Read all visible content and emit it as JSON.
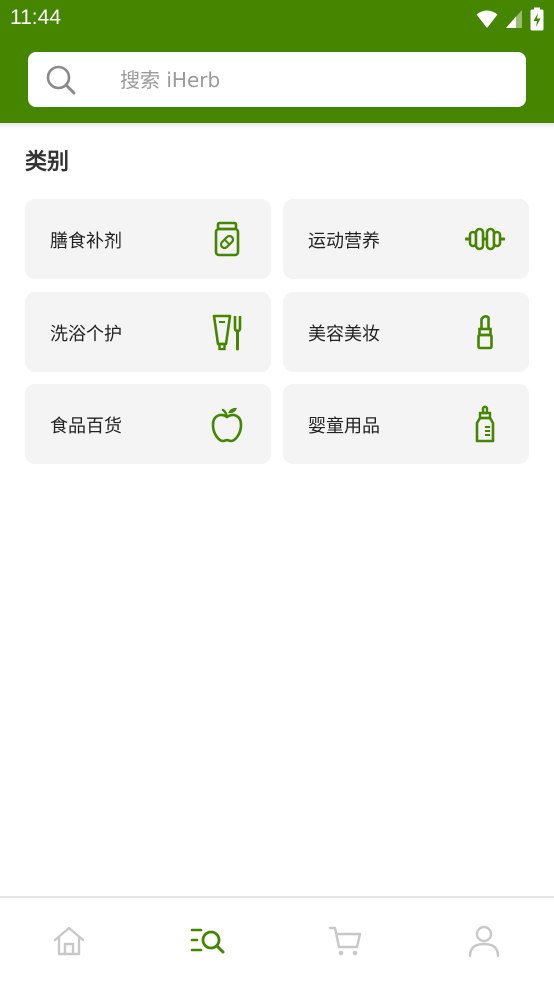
{
  "status_bar": {
    "time": "11:44"
  },
  "search": {
    "placeholder": "搜索 iHerb",
    "value": ""
  },
  "section": {
    "title": "类别"
  },
  "categories": [
    {
      "label": "膳食补剂",
      "icon": "supplement-jar-icon"
    },
    {
      "label": "运动营养",
      "icon": "dumbbell-icon"
    },
    {
      "label": "洗浴个护",
      "icon": "tube-and-brush-icon"
    },
    {
      "label": "美容美妆",
      "icon": "lipstick-icon"
    },
    {
      "label": "食品百货",
      "icon": "apple-icon"
    },
    {
      "label": "婴童用品",
      "icon": "baby-bottle-icon"
    }
  ],
  "bottom_nav": [
    {
      "name": "home",
      "icon": "home-icon",
      "active": false
    },
    {
      "name": "browse",
      "icon": "browse-search-icon",
      "active": true
    },
    {
      "name": "cart",
      "icon": "cart-icon",
      "active": false
    },
    {
      "name": "account",
      "icon": "account-icon",
      "active": false
    }
  ],
  "colors": {
    "brand": "#458500",
    "card_bg": "#f4f4f4",
    "inactive_icon": "#c8c8c8"
  }
}
